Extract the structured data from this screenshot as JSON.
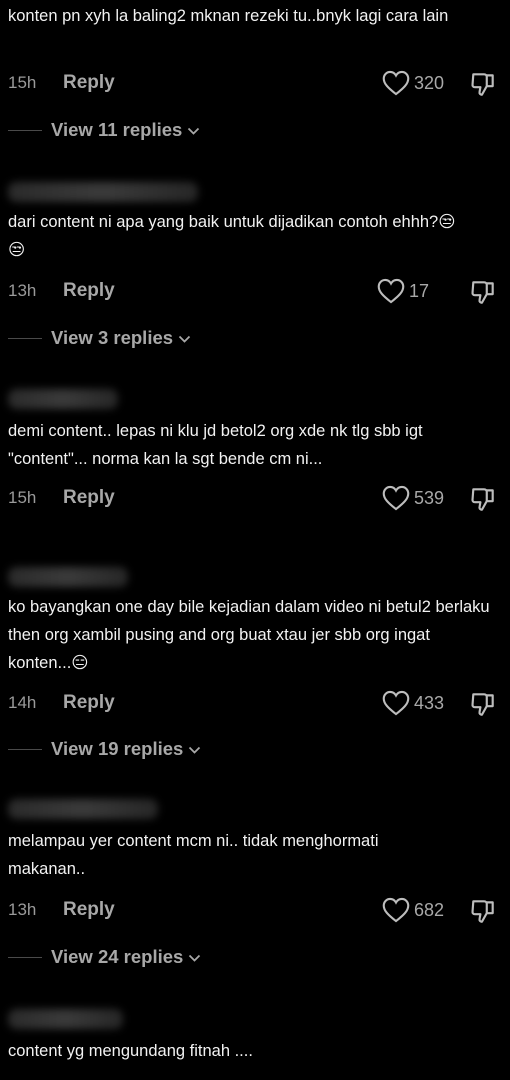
{
  "comments": [
    {
      "text": "konten pn xyh la baling2 mknan rezeki tu..bnyk lagi cara lain",
      "time": "15h",
      "reply_label": "Reply",
      "likes": "320",
      "view_replies": "View 11 replies"
    },
    {
      "text": "dari content ni apa yang baik untuk dijadikan contoh ehhh?😒😒",
      "time": "13h",
      "reply_label": "Reply",
      "likes": "17",
      "view_replies": "View 3 replies"
    },
    {
      "text": "demi content.. lepas ni klu jd betol2 org xde nk tlg sbb igt \"content\"... norma kan la sgt bende cm ni...",
      "time": "15h",
      "reply_label": "Reply",
      "likes": "539",
      "view_replies": ""
    },
    {
      "text": "ko bayangkan one day bile kejadian dalam video ni betul2 berlaku then org xambil pusing and org buat xtau jer sbb org ingat konten...😑",
      "time": "14h",
      "reply_label": "Reply",
      "likes": "433",
      "view_replies": "View 19 replies"
    },
    {
      "text": "melampau yer content mcm ni.. tidak menghormati makanan..",
      "time": "13h",
      "reply_label": "Reply",
      "likes": "682",
      "view_replies": "View 24 replies"
    },
    {
      "text": "content yg mengundang fitnah ....",
      "time": "",
      "reply_label": "",
      "likes": "",
      "view_replies": ""
    }
  ]
}
